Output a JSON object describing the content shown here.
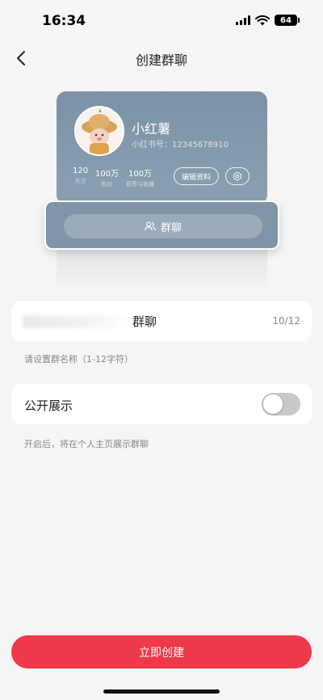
{
  "status_bar": {
    "time": "16:34",
    "battery": "64"
  },
  "nav": {
    "title": "创建群聊",
    "back_icon": "chevron-left-icon"
  },
  "preview_card": {
    "username": "小红薯",
    "user_id": "小红书号：12345678910",
    "stats": [
      {
        "value": "120",
        "label": "关注"
      },
      {
        "value": "100万",
        "label": "粉丝"
      },
      {
        "value": "100万",
        "label": "获赞与收藏"
      }
    ],
    "edit_label": "编辑资料",
    "settings_icon": "gear-icon",
    "group_label": "群聊",
    "group_icon": "users-icon"
  },
  "name_field": {
    "value": "群聊",
    "counter": "10/12",
    "hint": "请设置群名称（1-12字符）"
  },
  "public_setting": {
    "label": "公开展示",
    "enabled": false,
    "hint": "开启后，将在个人主页展示群聊"
  },
  "create_button": {
    "label": "立即创建"
  },
  "colors": {
    "accent": "#ee3a48",
    "card": "#7b92a6",
    "toggle_off": "#c9c9c9"
  }
}
